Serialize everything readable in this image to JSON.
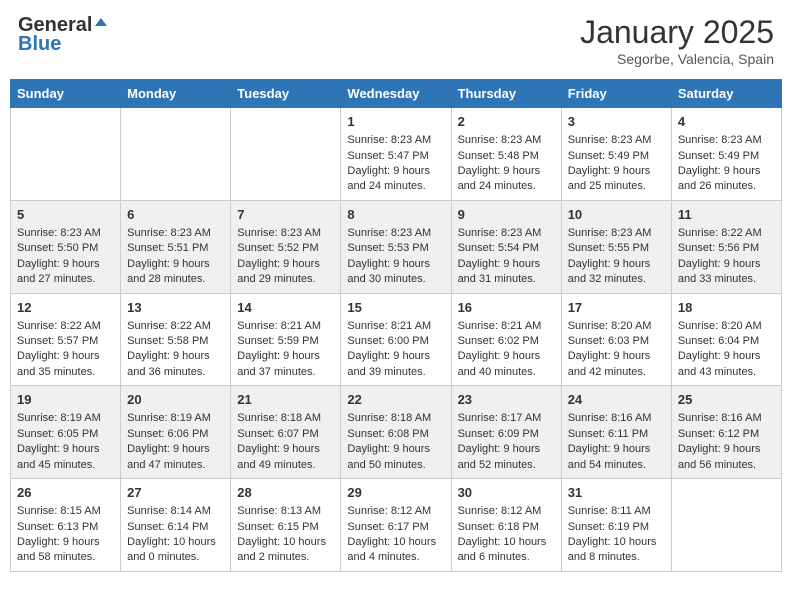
{
  "logo": {
    "general": "General",
    "blue": "Blue"
  },
  "title": "January 2025",
  "location": "Segorbe, Valencia, Spain",
  "days_of_week": [
    "Sunday",
    "Monday",
    "Tuesday",
    "Wednesday",
    "Thursday",
    "Friday",
    "Saturday"
  ],
  "weeks": [
    [
      {
        "day": "",
        "info": ""
      },
      {
        "day": "",
        "info": ""
      },
      {
        "day": "",
        "info": ""
      },
      {
        "day": "1",
        "info": "Sunrise: 8:23 AM\nSunset: 5:47 PM\nDaylight: 9 hours\nand 24 minutes."
      },
      {
        "day": "2",
        "info": "Sunrise: 8:23 AM\nSunset: 5:48 PM\nDaylight: 9 hours\nand 24 minutes."
      },
      {
        "day": "3",
        "info": "Sunrise: 8:23 AM\nSunset: 5:49 PM\nDaylight: 9 hours\nand 25 minutes."
      },
      {
        "day": "4",
        "info": "Sunrise: 8:23 AM\nSunset: 5:49 PM\nDaylight: 9 hours\nand 26 minutes."
      }
    ],
    [
      {
        "day": "5",
        "info": "Sunrise: 8:23 AM\nSunset: 5:50 PM\nDaylight: 9 hours\nand 27 minutes."
      },
      {
        "day": "6",
        "info": "Sunrise: 8:23 AM\nSunset: 5:51 PM\nDaylight: 9 hours\nand 28 minutes."
      },
      {
        "day": "7",
        "info": "Sunrise: 8:23 AM\nSunset: 5:52 PM\nDaylight: 9 hours\nand 29 minutes."
      },
      {
        "day": "8",
        "info": "Sunrise: 8:23 AM\nSunset: 5:53 PM\nDaylight: 9 hours\nand 30 minutes."
      },
      {
        "day": "9",
        "info": "Sunrise: 8:23 AM\nSunset: 5:54 PM\nDaylight: 9 hours\nand 31 minutes."
      },
      {
        "day": "10",
        "info": "Sunrise: 8:23 AM\nSunset: 5:55 PM\nDaylight: 9 hours\nand 32 minutes."
      },
      {
        "day": "11",
        "info": "Sunrise: 8:22 AM\nSunset: 5:56 PM\nDaylight: 9 hours\nand 33 minutes."
      }
    ],
    [
      {
        "day": "12",
        "info": "Sunrise: 8:22 AM\nSunset: 5:57 PM\nDaylight: 9 hours\nand 35 minutes."
      },
      {
        "day": "13",
        "info": "Sunrise: 8:22 AM\nSunset: 5:58 PM\nDaylight: 9 hours\nand 36 minutes."
      },
      {
        "day": "14",
        "info": "Sunrise: 8:21 AM\nSunset: 5:59 PM\nDaylight: 9 hours\nand 37 minutes."
      },
      {
        "day": "15",
        "info": "Sunrise: 8:21 AM\nSunset: 6:00 PM\nDaylight: 9 hours\nand 39 minutes."
      },
      {
        "day": "16",
        "info": "Sunrise: 8:21 AM\nSunset: 6:02 PM\nDaylight: 9 hours\nand 40 minutes."
      },
      {
        "day": "17",
        "info": "Sunrise: 8:20 AM\nSunset: 6:03 PM\nDaylight: 9 hours\nand 42 minutes."
      },
      {
        "day": "18",
        "info": "Sunrise: 8:20 AM\nSunset: 6:04 PM\nDaylight: 9 hours\nand 43 minutes."
      }
    ],
    [
      {
        "day": "19",
        "info": "Sunrise: 8:19 AM\nSunset: 6:05 PM\nDaylight: 9 hours\nand 45 minutes."
      },
      {
        "day": "20",
        "info": "Sunrise: 8:19 AM\nSunset: 6:06 PM\nDaylight: 9 hours\nand 47 minutes."
      },
      {
        "day": "21",
        "info": "Sunrise: 8:18 AM\nSunset: 6:07 PM\nDaylight: 9 hours\nand 49 minutes."
      },
      {
        "day": "22",
        "info": "Sunrise: 8:18 AM\nSunset: 6:08 PM\nDaylight: 9 hours\nand 50 minutes."
      },
      {
        "day": "23",
        "info": "Sunrise: 8:17 AM\nSunset: 6:09 PM\nDaylight: 9 hours\nand 52 minutes."
      },
      {
        "day": "24",
        "info": "Sunrise: 8:16 AM\nSunset: 6:11 PM\nDaylight: 9 hours\nand 54 minutes."
      },
      {
        "day": "25",
        "info": "Sunrise: 8:16 AM\nSunset: 6:12 PM\nDaylight: 9 hours\nand 56 minutes."
      }
    ],
    [
      {
        "day": "26",
        "info": "Sunrise: 8:15 AM\nSunset: 6:13 PM\nDaylight: 9 hours\nand 58 minutes."
      },
      {
        "day": "27",
        "info": "Sunrise: 8:14 AM\nSunset: 6:14 PM\nDaylight: 10 hours\nand 0 minutes."
      },
      {
        "day": "28",
        "info": "Sunrise: 8:13 AM\nSunset: 6:15 PM\nDaylight: 10 hours\nand 2 minutes."
      },
      {
        "day": "29",
        "info": "Sunrise: 8:12 AM\nSunset: 6:17 PM\nDaylight: 10 hours\nand 4 minutes."
      },
      {
        "day": "30",
        "info": "Sunrise: 8:12 AM\nSunset: 6:18 PM\nDaylight: 10 hours\nand 6 minutes."
      },
      {
        "day": "31",
        "info": "Sunrise: 8:11 AM\nSunset: 6:19 PM\nDaylight: 10 hours\nand 8 minutes."
      },
      {
        "day": "",
        "info": ""
      }
    ]
  ]
}
